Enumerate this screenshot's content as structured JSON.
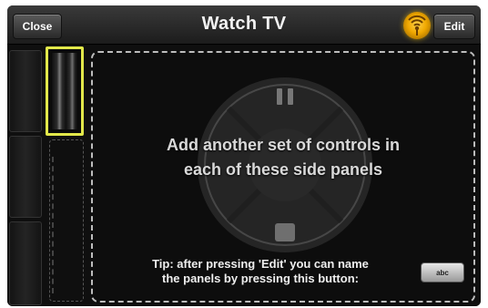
{
  "header": {
    "title": "Watch TV",
    "close_label": "Close",
    "edit_label": "Edit",
    "signal_icon": "broadcast-signal-icon"
  },
  "main_panel": {
    "message_line1": "Add another set of controls in",
    "message_line2": "each of these side panels",
    "tip_line1": "Tip: after pressing 'Edit' you can name",
    "tip_line2": "the panels by pressing this button:",
    "rename_button_label": "abc",
    "dpad_pause_icon": "pause-icon",
    "dpad_stop_icon": "stop-icon"
  },
  "colors": {
    "highlight": "#e2e84a",
    "signal": "#f0a800",
    "panel_border": "#bdbdbd"
  }
}
